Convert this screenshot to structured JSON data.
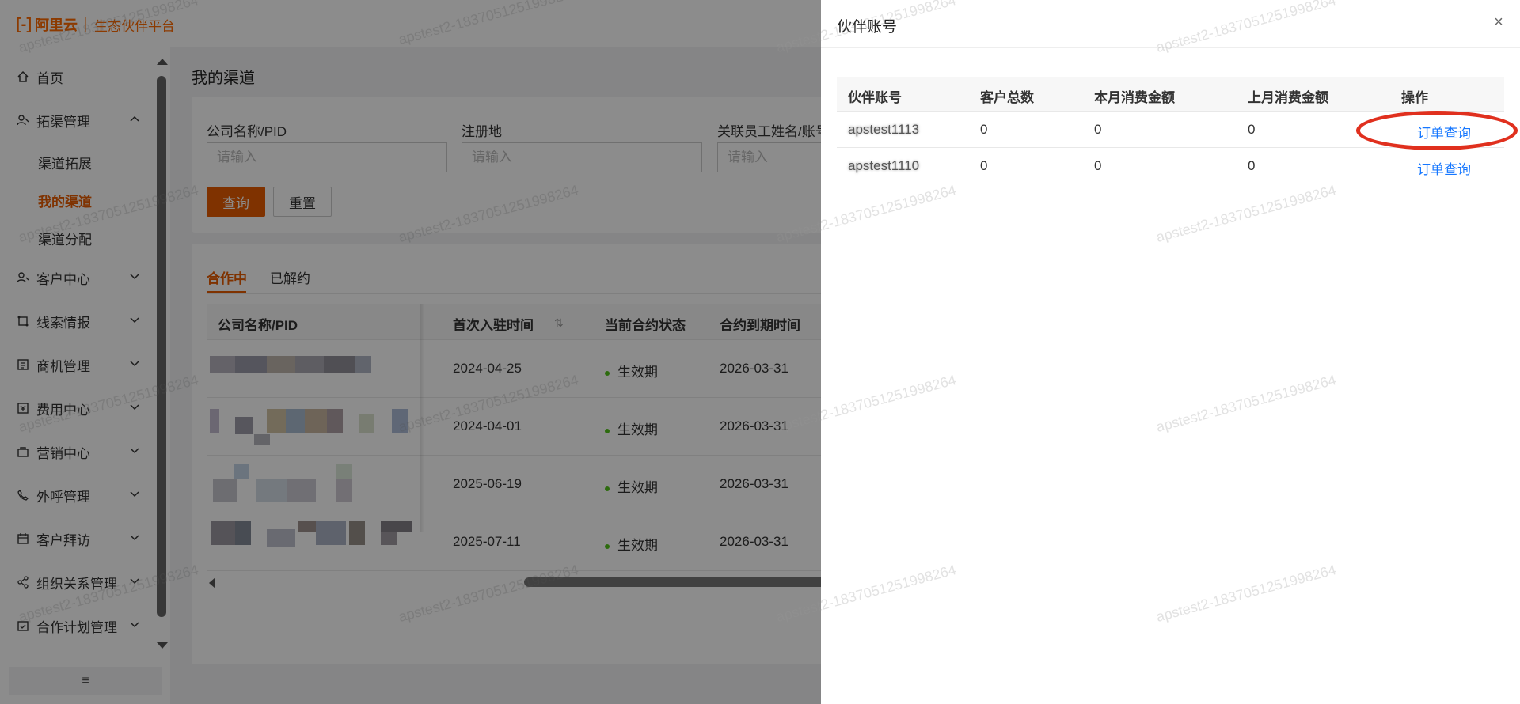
{
  "header": {
    "logo_mark": "[-]",
    "brand": "阿里云",
    "platform": "生态伙伴平台"
  },
  "sidebar": {
    "items": [
      {
        "label": "首页",
        "icon": "home-icon"
      },
      {
        "label": "拓渠管理",
        "icon": "users-icon",
        "expanded": true
      },
      {
        "label": "客户中心",
        "icon": "customer-icon"
      },
      {
        "label": "线索情报",
        "icon": "lead-icon"
      },
      {
        "label": "商机管理",
        "icon": "document-icon"
      },
      {
        "label": "费用中心",
        "icon": "yen-icon"
      },
      {
        "label": "营销中心",
        "icon": "bag-icon"
      },
      {
        "label": "外呼管理",
        "icon": "phone-icon"
      },
      {
        "label": "客户拜访",
        "icon": "calendar-icon"
      },
      {
        "label": "组织关系管理",
        "icon": "share-icon"
      },
      {
        "label": "合作计划管理",
        "icon": "plan-icon"
      }
    ],
    "subitems": [
      {
        "label": "渠道拓展"
      },
      {
        "label": "我的渠道",
        "active": true
      },
      {
        "label": "渠道分配"
      }
    ],
    "collapse_label": "≡"
  },
  "main": {
    "title": "我的渠道",
    "filters": [
      {
        "label": "公司名称/PID",
        "placeholder": "请输入"
      },
      {
        "label": "注册地",
        "placeholder": "请输入"
      },
      {
        "label": "关联员工姓名/账号",
        "placeholder": "请输入"
      }
    ],
    "query_label": "查询",
    "reset_label": "重置",
    "tabs": [
      {
        "label": "合作中",
        "active": true
      },
      {
        "label": "已解约"
      }
    ],
    "columns": [
      "公司名称/PID",
      "首次入驻时间",
      "当前合约状态",
      "合约到期时间"
    ],
    "rows": [
      {
        "first_join": "2024-04-25",
        "status": "生效期",
        "expire": "2026-03-31"
      },
      {
        "first_join": "2024-04-01",
        "status": "生效期",
        "expire": "2026-03-31"
      },
      {
        "first_join": "2025-06-19",
        "status": "生效期",
        "expire": "2026-03-31"
      },
      {
        "first_join": "2025-07-11",
        "status": "生效期",
        "expire": "2026-03-31"
      }
    ]
  },
  "drawer": {
    "title": "伙伴账号",
    "close_label": "×",
    "columns": [
      "伙伴账号",
      "客户总数",
      "本月消费金额",
      "上月消费金额",
      "操作"
    ],
    "rows": [
      {
        "account": "apstest1113",
        "customers": "0",
        "this_month": "0",
        "last_month": "0",
        "action": "订单查询"
      },
      {
        "account": "apstest1110",
        "customers": "0",
        "this_month": "0",
        "last_month": "0",
        "action": "订单查询"
      }
    ]
  },
  "watermark": "apstest2-1837051251998264",
  "colors": {
    "accent": "#e85c00",
    "link": "#1677ff",
    "status_active": "#52c41a",
    "annotation": "#e0301e"
  }
}
